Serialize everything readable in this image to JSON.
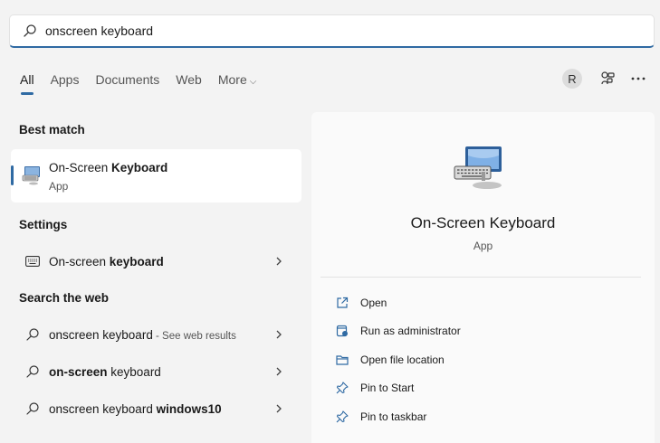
{
  "search": {
    "query": "onscreen keyboard",
    "icon": "search-icon"
  },
  "tabs": [
    {
      "label": "All",
      "active": true
    },
    {
      "label": "Apps"
    },
    {
      "label": "Documents"
    },
    {
      "label": "Web"
    },
    {
      "label": "More"
    }
  ],
  "header_right": {
    "avatar_initial": "R",
    "icons": [
      "connect-devices-icon",
      "more-icon"
    ]
  },
  "sections": {
    "best_match": "Best match",
    "settings": "Settings",
    "search_web": "Search the web"
  },
  "best_match": {
    "name_prefix": "On-Screen ",
    "name_bold": "Keyboard",
    "type": "App"
  },
  "settings_item": {
    "prefix": "On-screen ",
    "bold": "keyboard"
  },
  "web_results": [
    {
      "prefix": "onscreen keyboard",
      "bold": "",
      "suffix": " - See web results"
    },
    {
      "prefix": "",
      "bold": "on-screen",
      "suffix2": " keyboard"
    },
    {
      "prefix": "onscreen keyboard ",
      "bold": "windows10"
    }
  ],
  "preview": {
    "title": "On-Screen Keyboard",
    "type": "App",
    "actions": [
      {
        "label": "Open",
        "icon": "open-icon"
      },
      {
        "label": "Run as administrator",
        "icon": "shield-admin-icon"
      },
      {
        "label": "Open file location",
        "icon": "folder-icon"
      },
      {
        "label": "Pin to Start",
        "icon": "pin-icon"
      },
      {
        "label": "Pin to taskbar",
        "icon": "pin-icon"
      }
    ]
  },
  "colors": {
    "accent": "#2f6aa3",
    "background": "#f3f3f3",
    "card": "#ffffff"
  }
}
